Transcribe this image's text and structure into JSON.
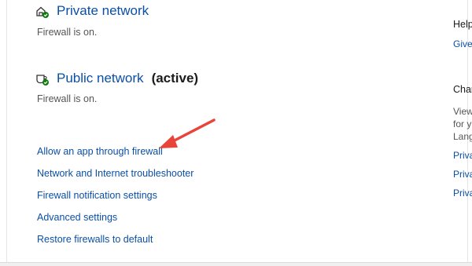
{
  "private_network": {
    "title": "Private network",
    "status": "Firewall is on."
  },
  "public_network": {
    "title": "Public network",
    "active_label": "(active)",
    "status": "Firewall is on."
  },
  "links": {
    "allow_app": "Allow an app through firewall",
    "troubleshooter": "Network and Internet troubleshooter",
    "notification_settings": "Firewall notification settings",
    "advanced_settings": "Advanced settings",
    "restore_defaults": "Restore firewalls to default"
  },
  "side_panel": {
    "help_heading": "Help",
    "give_feedback": "Give",
    "change_heading": "Chan",
    "view_line1": "View",
    "view_line2": "for y",
    "view_line3": "Lang",
    "privacy_link_1": "Priva",
    "privacy_link_2": "Priva",
    "privacy_link_3": "Priva"
  },
  "icons": {
    "private_network": "home-network-shield-icon",
    "public_network": "coffee-cup-shield-icon",
    "annotation": "red-arrow"
  },
  "colors": {
    "link": "#0b4fa5",
    "status_ok": "#107c10",
    "annotation_arrow": "#e8443a"
  }
}
